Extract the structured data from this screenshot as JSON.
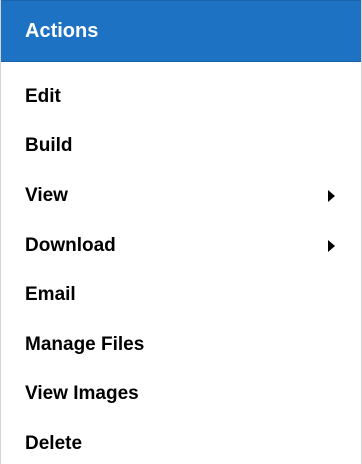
{
  "menu": {
    "header_title": "Actions",
    "colors": {
      "header_bg": "#1e72c4",
      "header_text": "#ffffff",
      "item_text": "#000000"
    },
    "items": [
      {
        "label": "Edit",
        "submenu": false
      },
      {
        "label": "Build",
        "submenu": false
      },
      {
        "label": "View",
        "submenu": true,
        "icon": "triangle-right-icon"
      },
      {
        "label": "Download",
        "submenu": true,
        "icon": "triangle-right-icon"
      },
      {
        "label": "Email",
        "submenu": false
      },
      {
        "label": "Manage Files",
        "submenu": false
      },
      {
        "label": "View Images",
        "submenu": false
      },
      {
        "label": "Delete",
        "submenu": false
      }
    ]
  }
}
